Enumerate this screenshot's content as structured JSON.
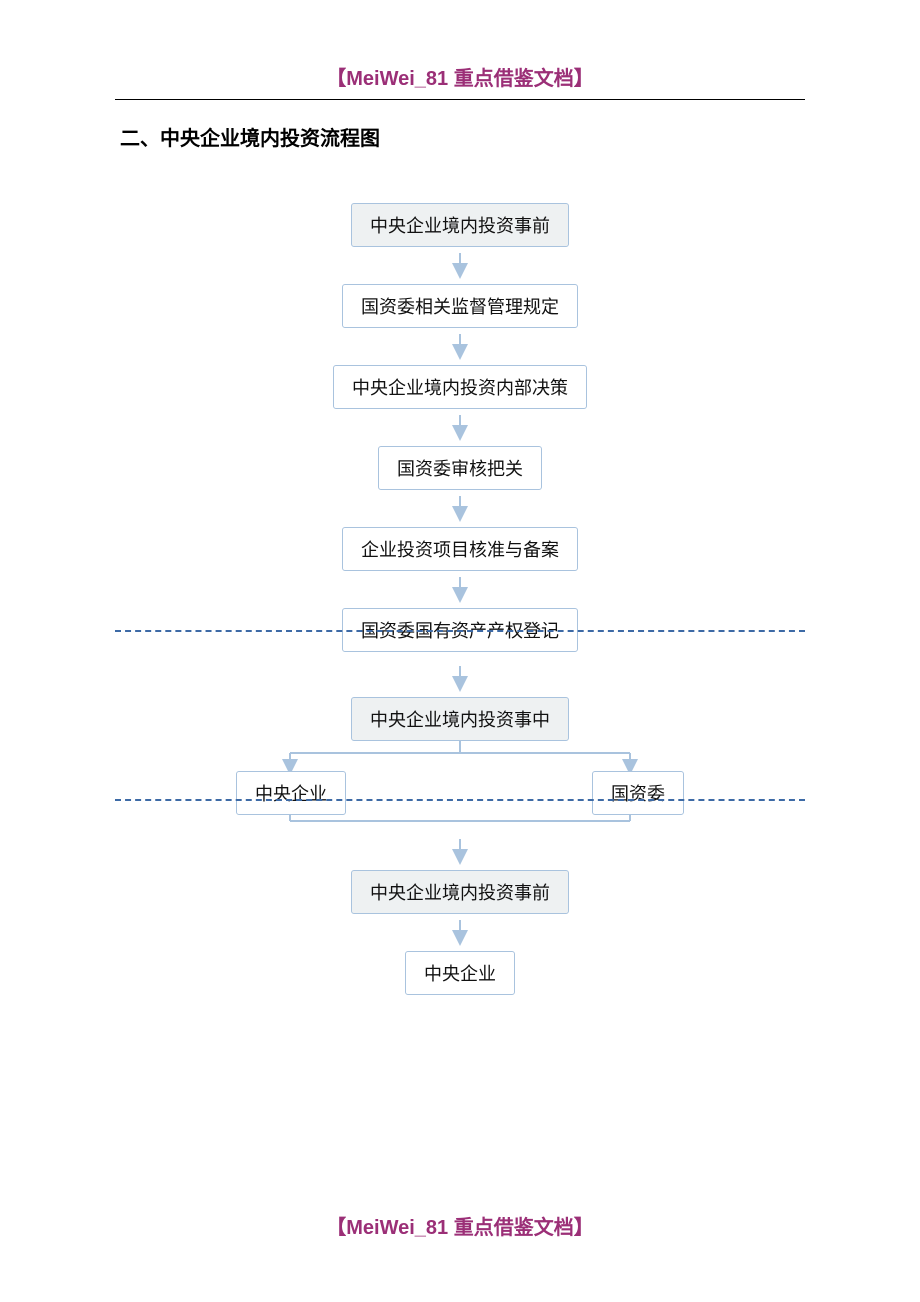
{
  "header": "【MeiWei_81 重点借鉴文档】",
  "footer": "【MeiWei_81 重点借鉴文档】",
  "section_title": "二、中央企业境内投资流程图",
  "flow": {
    "section1": {
      "head": "中央企业境内投资事前",
      "steps": [
        "国资委相关监督管理规定",
        "中央企业境内投资内部决策",
        "国资委审核把关",
        "企业投资项目核准与备案",
        "国资委国有资产产权登记"
      ]
    },
    "section2": {
      "head": "中央企业境内投资事中",
      "left": "中央企业",
      "right": "国资委"
    },
    "section3": {
      "head": "中央企业境内投资事前",
      "step": "中央企业"
    }
  }
}
